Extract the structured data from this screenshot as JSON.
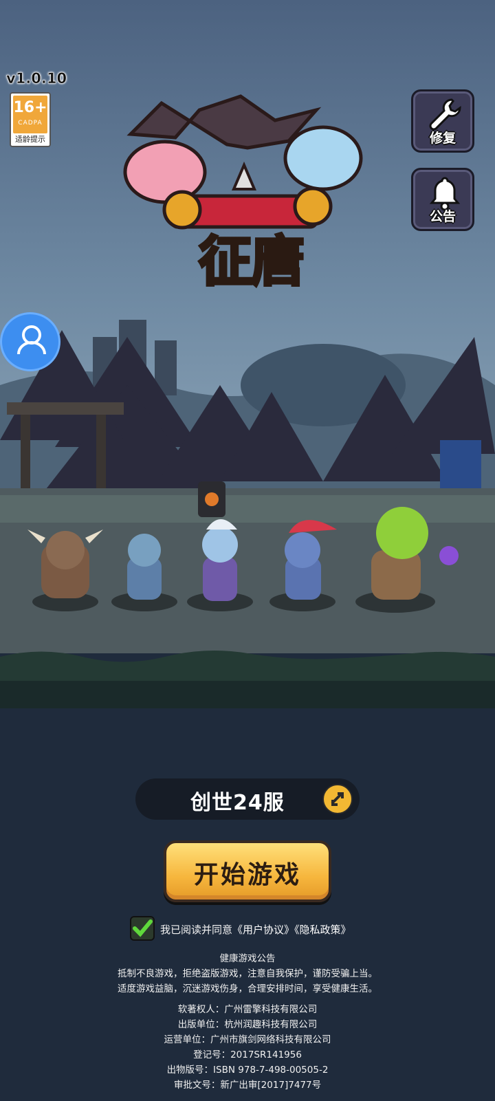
{
  "version": "v1.0.10",
  "age_rating": {
    "label": "16+",
    "org": "CADPA",
    "tip": "适龄提示"
  },
  "side_buttons": {
    "repair": "修复",
    "announcement": "公告"
  },
  "logo_text": "征唐",
  "server": {
    "name": "创世24服"
  },
  "start_button": "开始游戏",
  "agreement": {
    "prefix": "我已阅读并同意",
    "user_agreement": "《用户协议》",
    "privacy_policy": "《隐私政策》",
    "checked": true
  },
  "health_notice": {
    "title": "健康游戏公告",
    "line1": "抵制不良游戏，拒绝盗版游戏，注意自我保护，谨防受骗上当。",
    "line2": "适度游戏益脑，沉迷游戏伤身，合理安排时间，享受健康生活。"
  },
  "credits": {
    "copyright": "软著权人：广州雷擎科技有限公司",
    "publisher": "出版单位：杭州润趣科技有限公司",
    "operator": "运营单位：广州市旗剑网络科技有限公司",
    "registration": "登记号：2017SR141956",
    "isbn": "出物版号：ISBN 978-7-498-00505-2",
    "approval": "审批文号：新广出审[2017]7477号"
  },
  "colors": {
    "accent": "#f6b63d",
    "sky": "#4a607c",
    "ground": "#1f2b3c"
  }
}
